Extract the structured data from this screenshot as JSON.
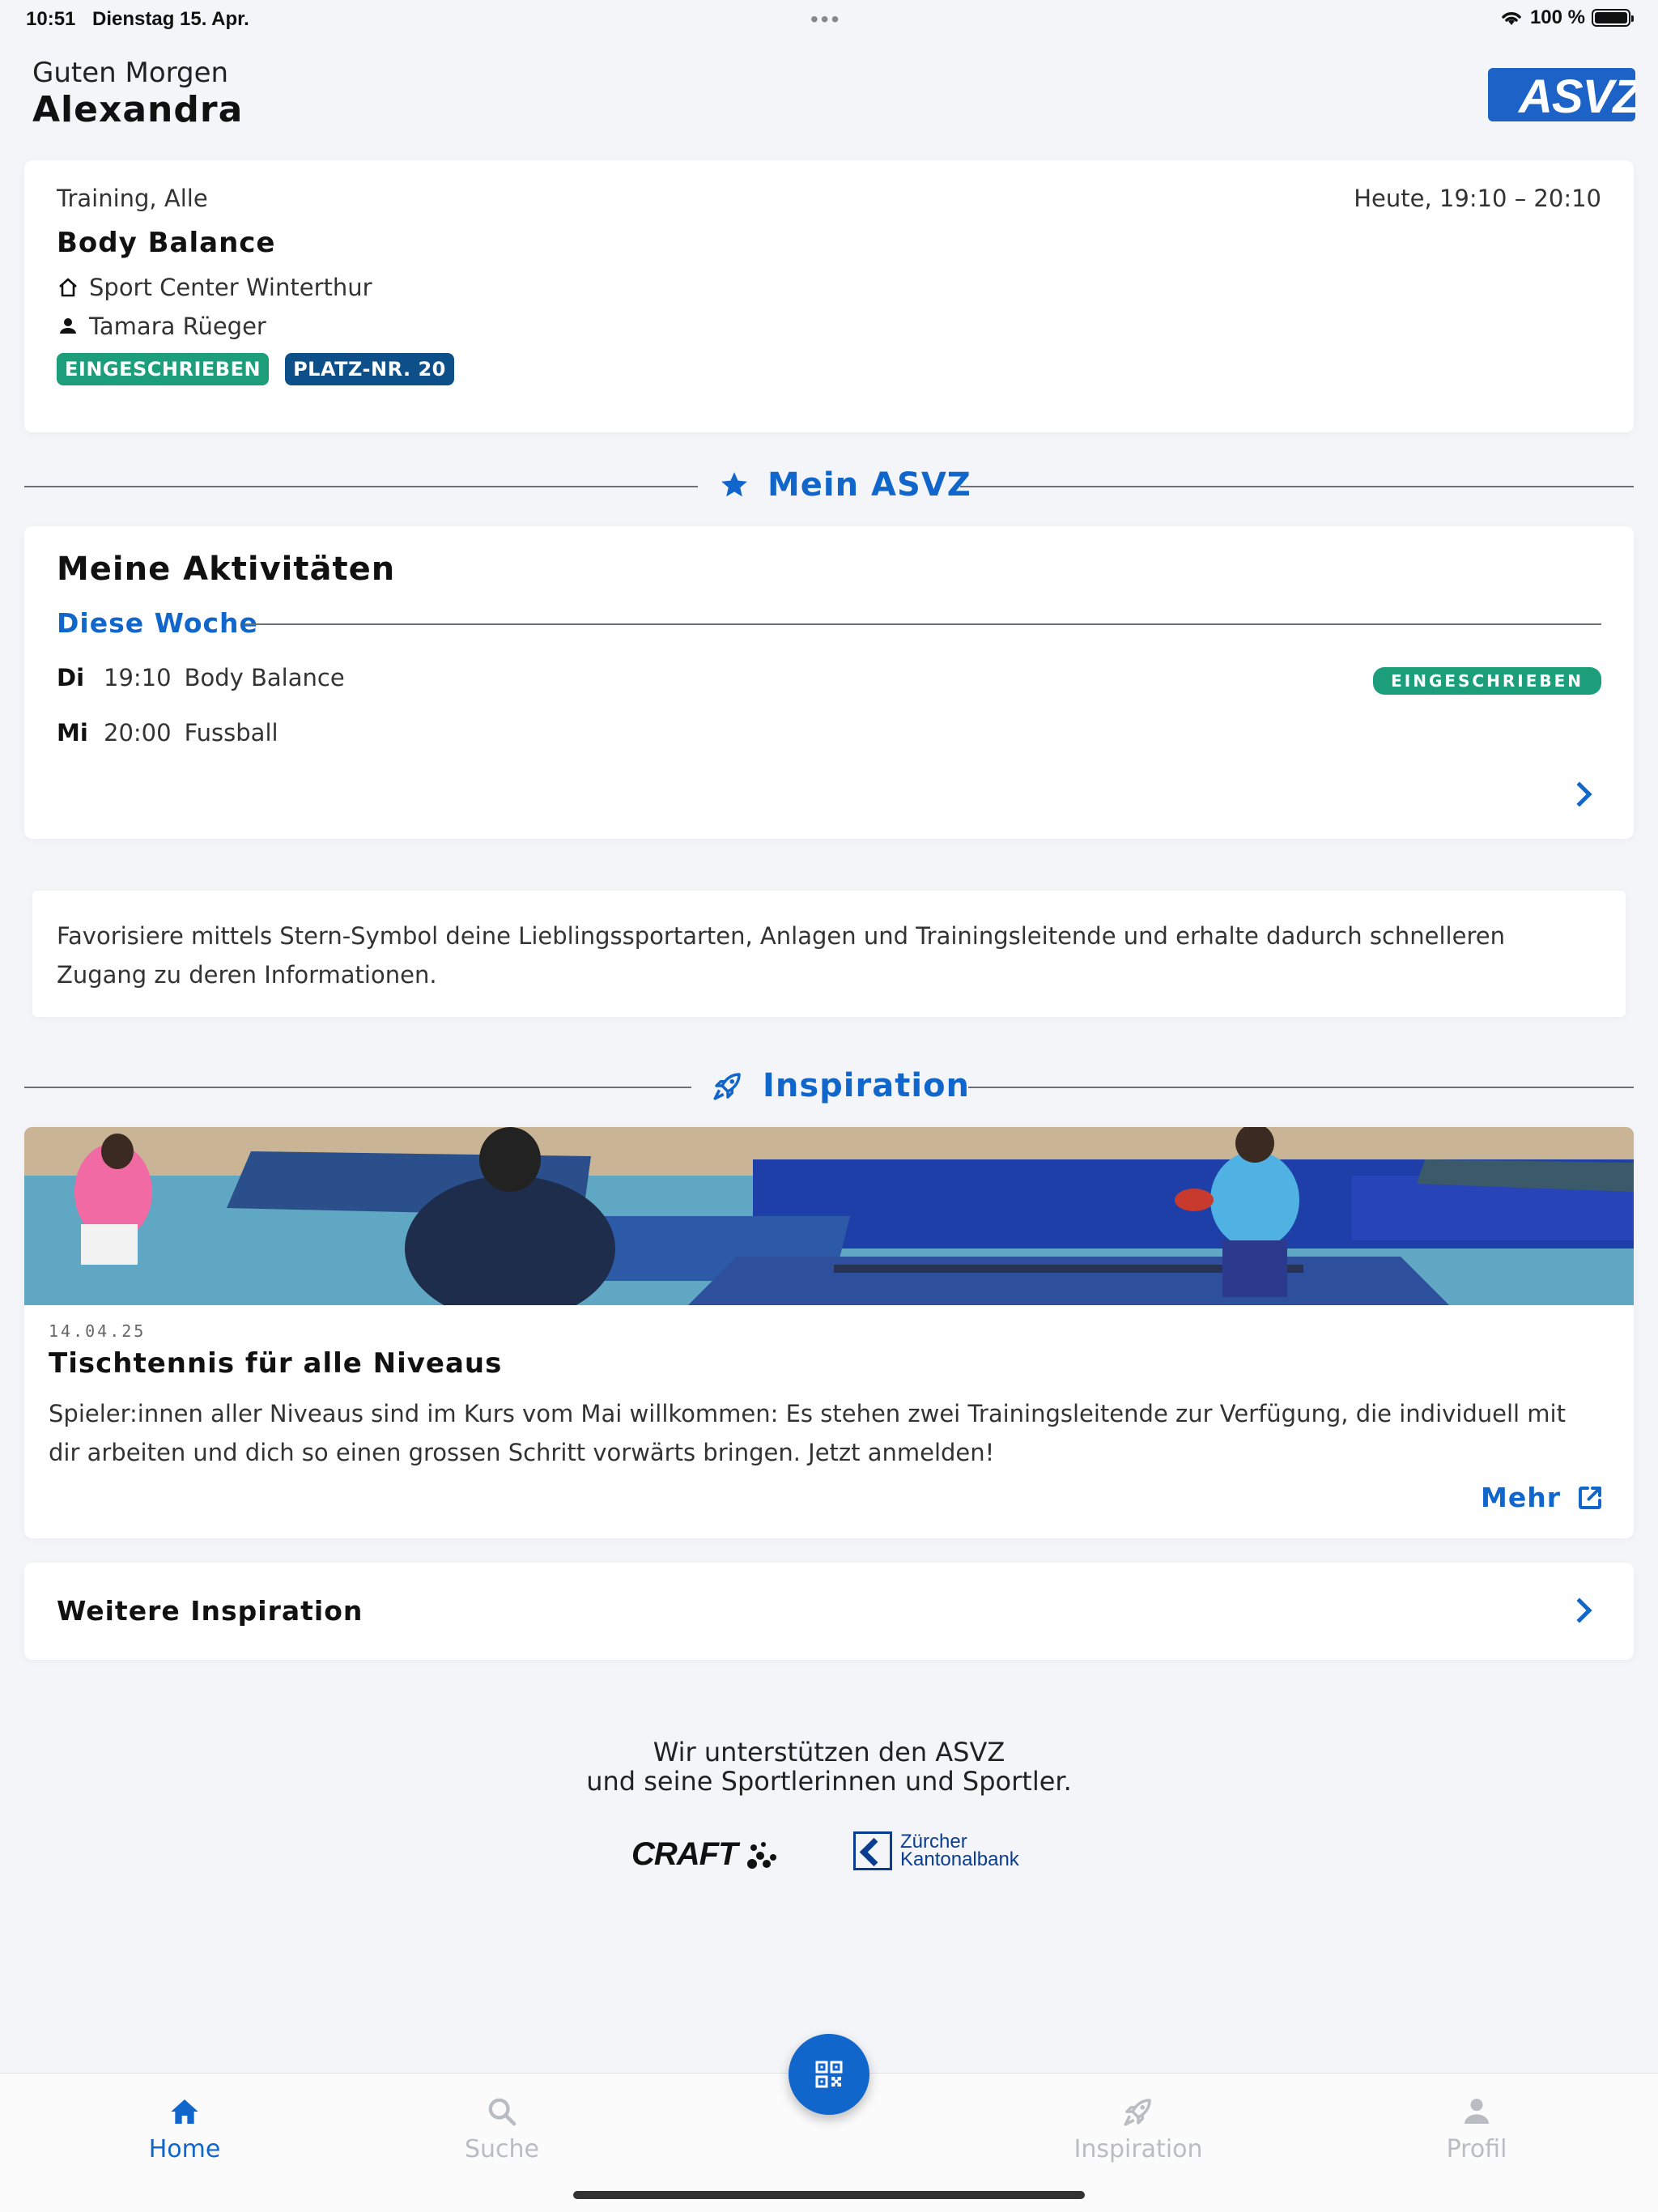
{
  "status_bar": {
    "time": "10:51",
    "date": "Dienstag 15. Apr.",
    "battery": "100 %"
  },
  "greeting": {
    "line1": "Guten Morgen",
    "name": "Alexandra"
  },
  "logo": {
    "text": "ASVZ"
  },
  "next_training": {
    "category": "Training, Alle",
    "time": "Heute, 19:10 – 20:10",
    "title": "Body Balance",
    "location": "Sport Center Winterthur",
    "trainer": "Tamara Rüeger",
    "badge_enrolled": "EINGESCHRIEBEN",
    "badge_place": "PLATZ-NR. 20"
  },
  "mein_asvz": {
    "section_title": "Mein ASVZ",
    "card_title": "Meine Aktivitäten",
    "week_label": "Diese Woche",
    "activities": [
      {
        "day": "Di",
        "time": "19:10",
        "name": "Body Balance",
        "badge": "EINGESCHRIEBEN"
      },
      {
        "day": "Mi",
        "time": "20:00",
        "name": "Fussball",
        "badge": ""
      }
    ]
  },
  "hint": {
    "text": "Favorisiere mittels Stern-Symbol deine Lieblingssportarten, Anlagen und Trainingsleitende und erhalte dadurch schnelleren Zugang zu deren Informationen."
  },
  "inspiration": {
    "section_title": "Inspiration",
    "article": {
      "date": "14.04.25",
      "title": "Tischtennis für alle Niveaus",
      "body": "Spieler:innen aller Niveaus sind im Kurs vom Mai willkommen: Es stehen zwei Trainingsleitende zur Verfügung, die individuell mit dir arbeiten und dich so einen grossen Schritt vorwärts bringen. Jetzt anmelden!",
      "more_label": "Mehr"
    },
    "more_inspiration_label": "Weitere Inspiration"
  },
  "sponsors": {
    "line1": "Wir unterstützen den ASVZ",
    "line2": "und seine Sportlerinnen und Sportler.",
    "craft": "CRAFT",
    "zkb_line1": "Zürcher",
    "zkb_line2": "Kantonalbank"
  },
  "tabs": [
    {
      "label": "Home",
      "icon": "home-icon",
      "active": true
    },
    {
      "label": "Suche",
      "icon": "search-icon",
      "active": false
    },
    {
      "label": "Inspiration",
      "icon": "rocket-icon",
      "active": false
    },
    {
      "label": "Profil",
      "icon": "person-icon",
      "active": false
    }
  ],
  "colors": {
    "accent": "#1166cc",
    "enrolled_green": "#1c9e7a",
    "place_navy": "#0d4f88",
    "background": "#f4f5f8"
  }
}
